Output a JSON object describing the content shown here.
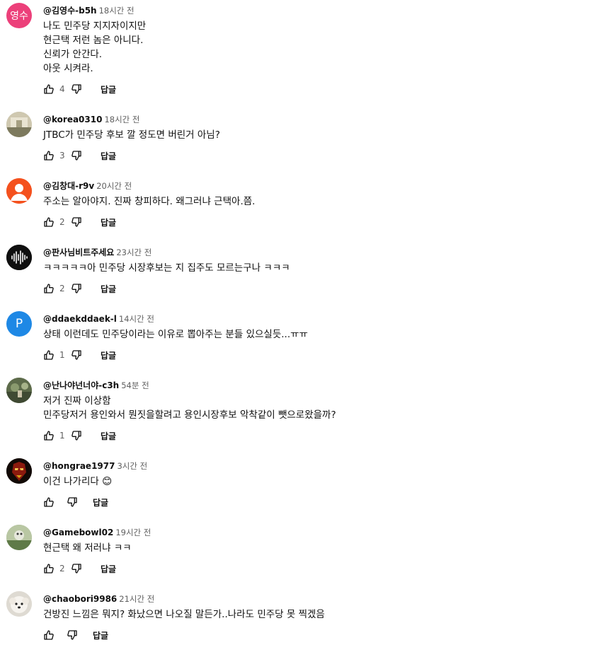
{
  "comments": [
    {
      "author": "@김영수-b5h",
      "time": "18시간 전",
      "avatar_text": "영수",
      "avatar_color": "#ec407a",
      "lines": [
        "나도 민주당 지지자이지만",
        "현근택 저런 놈은 아니다.",
        "신뢰가 안간다.",
        "아웃 시켜라."
      ],
      "likes": "4",
      "reply_label": "답글"
    },
    {
      "author": "@korea0310",
      "time": "18시간 전",
      "avatar_text": "",
      "avatar_color": "#b8b59a",
      "lines": [
        "JTBC가 민주당 후보 깔 정도면 버린거 아님?"
      ],
      "likes": "3",
      "reply_label": "답글"
    },
    {
      "author": "@김창대-r9v",
      "time": "20시간 전",
      "avatar_text": "",
      "avatar_color": "#f4511e",
      "lines": [
        "주소는 알아야지. 진짜 창피하다. 왜그러냐 근택아.쯤."
      ],
      "likes": "2",
      "reply_label": "답글"
    },
    {
      "author": "@판사님비트주세요",
      "time": "23시간 전",
      "avatar_text": "",
      "avatar_color": "#0f0f0f",
      "lines": [
        "ㅋㅋㅋㅋㅋ아 민주당 시장후보는 지 집주도 모르는구나 ㅋㅋㅋ"
      ],
      "likes": "2",
      "reply_label": "답글"
    },
    {
      "author": "@ddaekddaek-l",
      "time": "14시간 전",
      "avatar_text": "P",
      "avatar_color": "#1e88e5",
      "lines": [
        "상태 이런데도 민주당이라는 이유로 뽑아주는 분들 있으실듯...ㅠㅠ"
      ],
      "likes": "1",
      "reply_label": "답글"
    },
    {
      "author": "@난나야넌너야-c3h",
      "time": "54분 전",
      "avatar_text": "",
      "avatar_color": "#6b7d5a",
      "lines": [
        "저거 진짜 이상함",
        "민주당저거 용인와서 뭔짓을할려고 용인시장후보 악착같이 뺏으로왔을까?"
      ],
      "likes": "1",
      "reply_label": "답글"
    },
    {
      "author": "@hongrae1977",
      "time": "3시간 전",
      "avatar_text": "",
      "avatar_color": "#1a0f0a",
      "lines": [
        "이건 나가리다 😊"
      ],
      "likes": "",
      "reply_label": "답글"
    },
    {
      "author": "@Gamebowl02",
      "time": "19시간 전",
      "avatar_text": "",
      "avatar_color": "#8fa77a",
      "lines": [
        "현근택 왜 저러냐 ㅋㅋ"
      ],
      "likes": "2",
      "reply_label": "답글"
    },
    {
      "author": "@chaobori9986",
      "time": "21시간 전",
      "avatar_text": "",
      "avatar_color": "#e8e4de",
      "lines": [
        "건방진 느낌은 뭐지? 화났으면 나오질 말든가..나라도 민주당 못 찍겠음"
      ],
      "likes": "",
      "reply_label": "답글"
    }
  ]
}
